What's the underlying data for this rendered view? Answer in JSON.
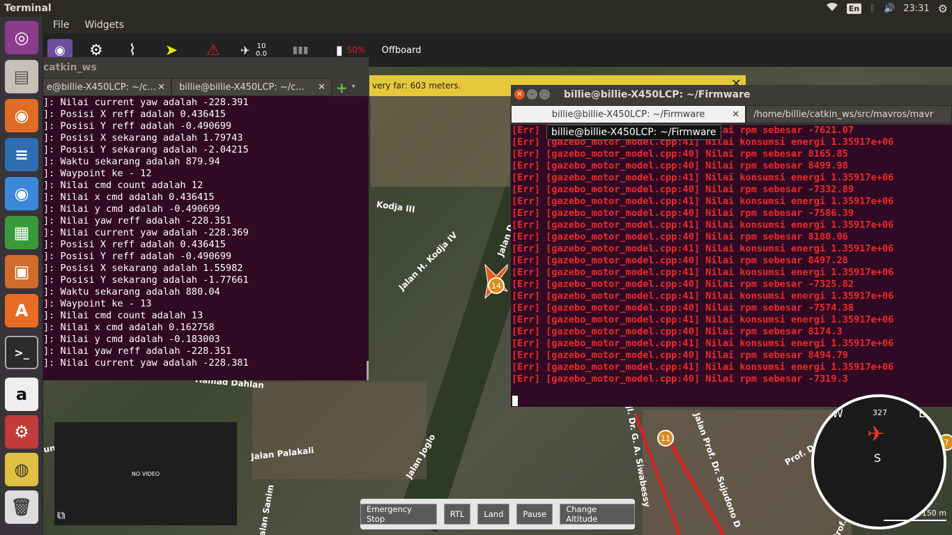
{
  "topbar": {
    "title": "Terminal",
    "lang": "En",
    "time": "23:31"
  },
  "menu": {
    "file": "File",
    "widgets": "Widgets"
  },
  "toolbar": {
    "gps_count": "10",
    "gps_hdop": "0.0",
    "battery": "50%",
    "mode": "Offboard"
  },
  "notice": {
    "text": "very far: 603 meters."
  },
  "term1": {
    "window_title_fragment": "catkin_ws",
    "tabs": [
      {
        "label": "e@billie-X450LCP: ~/c..."
      },
      {
        "label": "billie@billie-X450LCP: ~/c..."
      }
    ],
    "lines": [
      "]: Nilai current yaw adalah -228.391",
      "]: Posisi X reff adalah 0.436415",
      "]: Posisi Y reff adalah -0.490699",
      "]: Posisi X sekarang adalah 1.79743",
      "]: Posisi Y sekarang adalah -2.04215",
      "]: Waktu sekarang adalah 879.94",
      "]: Waypoint ke - 12",
      "]: Nilai cmd count adalah 12",
      "]: Nilai x cmd adalah 0.436415",
      "]: Nilai y cmd adalah -0.490699",
      "]: Nilai yaw reff adalah -228.351",
      "]: Nilai current yaw adalah -228.369",
      "]: Posisi X reff adalah 0.436415",
      "]: Posisi Y reff adalah -0.490699",
      "]: Posisi X sekarang adalah 1.55982",
      "]: Posisi Y sekarang adalah -1.77661",
      "]: Waktu sekarang adalah 880.04",
      "]: Waypoint ke - 13",
      "]: Nilai cmd count adalah 13",
      "]: Nilai x cmd adalah 0.162758",
      "]: Nilai y cmd adalah -0.183003",
      "]: Nilai yaw reff adalah -228.351",
      "]: Nilai current yaw adalah -228.381"
    ]
  },
  "term2": {
    "title": "billie@billie-X450LCP: ~/Firmware",
    "tabs": [
      {
        "label": "billie@billie-X450LCP: ~/Firmware"
      },
      {
        "label": "/home/billie/catkin_ws/src/mavros/mavr"
      }
    ],
    "tooltip": "billie@billie-X450LCP: ~/Firmware",
    "lines": [
      "[Err] [gazebo_motor_model.cpp:40] Nilai rpm sebesar -7621.07",
      "[Err] [gazebo_motor_model.cpp:41] Nilai konsumsi energi 1.35917e+06",
      "[Err] [gazebo_motor_model.cpp:40] Nilai rpm sebesar 8165.85",
      "[Err] [gazebo_motor_model.cpp:40] Nilai rpm sebesar 8499.98",
      "[Err] [gazebo_motor_model.cpp:41] Nilai konsumsi energi 1.35917e+06",
      "[Err] [gazebo_motor_model.cpp:40] Nilai rpm sebesar -7332.89",
      "[Err] [gazebo_motor_model.cpp:41] Nilai konsumsi energi 1.35917e+06",
      "[Err] [gazebo_motor_model.cpp:40] Nilai rpm sebesar -7586.39",
      "[Err] [gazebo_motor_model.cpp:41] Nilai konsumsi energi 1.35917e+06",
      "[Err] [gazebo_motor_model.cpp:40] Nilai rpm sebesar 8180.06",
      "[Err] [gazebo_motor_model.cpp:41] Nilai konsumsi energi 1.35917e+06",
      "[Err] [gazebo_motor_model.cpp:40] Nilai rpm sebesar 8497.28",
      "[Err] [gazebo_motor_model.cpp:41] Nilai konsumsi energi 1.35917e+06",
      "[Err] [gazebo_motor_model.cpp:40] Nilai rpm sebesar -7325.82",
      "[Err] [gazebo_motor_model.cpp:41] Nilai konsumsi energi 1.35917e+06",
      "[Err] [gazebo_motor_model.cpp:40] Nilai rpm sebesar -7574.38",
      "[Err] [gazebo_motor_model.cpp:41] Nilai konsumsi energi 1.35917e+06",
      "[Err] [gazebo_motor_model.cpp:40] Nilai rpm sebesar 8174.3",
      "[Err] [gazebo_motor_model.cpp:41] Nilai konsumsi energi 1.35917e+06",
      "[Err] [gazebo_motor_model.cpp:40] Nilai rpm sebesar 8494.79",
      "[Err] [gazebo_motor_model.cpp:41] Nilai konsumsi energi 1.35917e+06",
      "[Err] [gazebo_motor_model.cpp:40] Nilai rpm sebesar -7319.3"
    ]
  },
  "map": {
    "labels": [
      "Kodja III",
      "Jalan H. Kodja IV",
      "Jalan D",
      "Jalan Joglo",
      "Jalan Palakali",
      "Jalan Prof. Dr. Sujudono D",
      "Prof. Dr. Ma",
      "Jl. Dr. G. A. Siwabessy",
      "Jalan Sanim",
      "Prof. Dr. Suju",
      "Hamad Dahlan",
      "ungur Raya"
    ],
    "waypoints": [
      "14",
      "11",
      "7"
    ],
    "scale": "150 m"
  },
  "video": {
    "text": "NO VIDEO"
  },
  "actions": {
    "emergency": "Emergency Stop",
    "rtl": "RTL",
    "land": "Land",
    "pause": "Pause",
    "altitude": "Change Altitude"
  },
  "compass": {
    "heading": "327",
    "w": "W",
    "e": "E",
    "s": "S"
  }
}
